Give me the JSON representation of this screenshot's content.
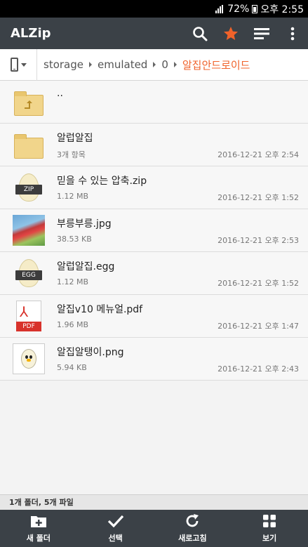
{
  "status": {
    "battery": "72%",
    "time": "오후 2:55"
  },
  "appbar": {
    "title": "ALZip",
    "icons": [
      "search-icon",
      "star-icon",
      "sort-icon",
      "more-vert-icon"
    ],
    "accent": "#f0622a"
  },
  "path": {
    "device_icon": "phone-icon",
    "crumbs": [
      "storage",
      "emulated",
      "0"
    ],
    "current": "알집안드로이드"
  },
  "files": [
    {
      "name": "..",
      "meta": "",
      "date": "",
      "kind": "parent-folder"
    },
    {
      "name": "알럽알집",
      "meta": "3개 항목",
      "date": "2016-12-21 오후 2:54",
      "kind": "folder"
    },
    {
      "name": "믿을 수 있는 압축.zip",
      "meta": "1.12 MB",
      "date": "2016-12-21 오후 1:52",
      "kind": "zip",
      "badge": "ZIP"
    },
    {
      "name": "부릉부릉.jpg",
      "meta": "38.53 KB",
      "date": "2016-12-21 오후 2:53",
      "kind": "jpg"
    },
    {
      "name": "알럽알집.egg",
      "meta": "1.12 MB",
      "date": "2016-12-21 오후 1:52",
      "kind": "egg",
      "badge": "EGG"
    },
    {
      "name": "알집v10 메뉴얼.pdf",
      "meta": "1.96 MB",
      "date": "2016-12-21 오후 1:47",
      "kind": "pdf",
      "badge": "PDF"
    },
    {
      "name": "알집알탱이.png",
      "meta": "5.94 KB",
      "date": "2016-12-21 오후 2:43",
      "kind": "png"
    }
  ],
  "summary": "1개 폴더, 5개 파일",
  "bottom": [
    {
      "label": "새 폴더",
      "icon": "new-folder-icon"
    },
    {
      "label": "선택",
      "icon": "check-icon"
    },
    {
      "label": "새로고침",
      "icon": "refresh-icon"
    },
    {
      "label": "보기",
      "icon": "grid-view-icon"
    }
  ]
}
